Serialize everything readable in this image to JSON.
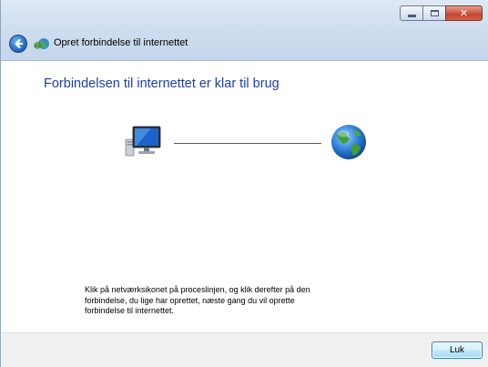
{
  "window": {
    "title": "Opret forbindelse til internettet",
    "controls": [
      "minimize",
      "maximize",
      "close"
    ]
  },
  "content": {
    "heading": "Forbindelsen til internettet er klar til brug",
    "diagram": {
      "left_icon": "computer-icon",
      "right_icon": "globe-icon"
    },
    "info_line1": "Klik på netværksikonet på proceslinjen, og klik derefter på den",
    "info_line2": "forbindelse, du lige har oprettet, næste gang du vil oprette",
    "info_line3": "forbindelse til internettet."
  },
  "footer": {
    "close_label": "Luk"
  },
  "colors": {
    "heading": "#1e3fa6",
    "chrome": "#cddcee",
    "footer": "#f0f0f0"
  }
}
